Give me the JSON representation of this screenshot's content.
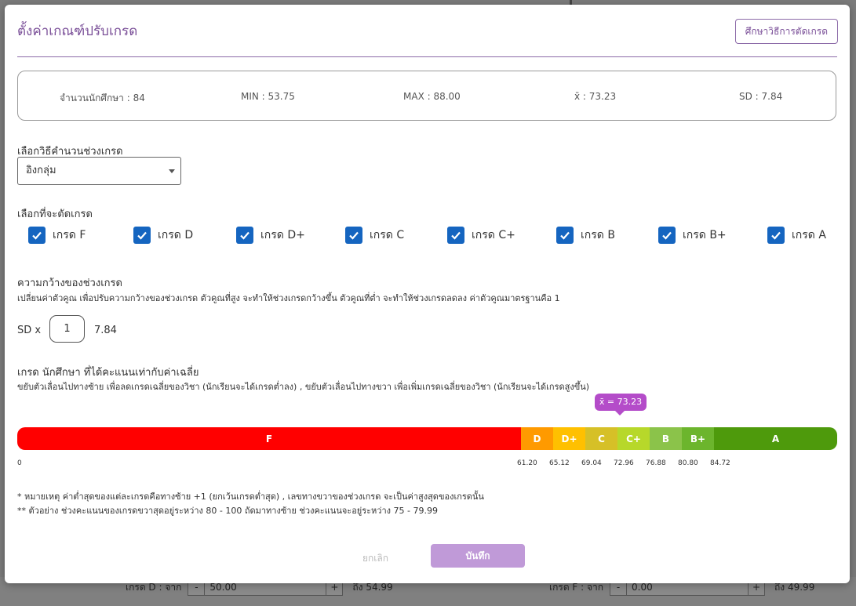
{
  "background": {
    "row_left": {
      "label": "เกรด D : จาก",
      "minus": "-",
      "value": "50.00",
      "plus": "+",
      "to": "ถึง 54.99"
    },
    "row_right": {
      "label": "เกรด F : จาก",
      "minus": "-",
      "value": "0.00",
      "plus": "+",
      "to": "ถึง 49.99"
    }
  },
  "modal": {
    "title": "ตั้งค่าเกณฑ์ปรับเกรด",
    "study_button": "ศึกษาวิธีการตัดเกรด"
  },
  "stats": {
    "count": "จำนวนนักศึกษา : 84",
    "min": "MIN : 53.75",
    "max": "MAX : 88.00",
    "mean": "x̄ : 73.23",
    "sd": "SD : 7.84"
  },
  "method": {
    "label": "เลือกวิธีคำนวนช่วงเกรด",
    "selected": "อิงกลุ่ม"
  },
  "cut_grades": {
    "label": "เลือกที่จะตัดเกรด",
    "items": [
      {
        "label": "เกรด F",
        "checked": true
      },
      {
        "label": "เกรด D",
        "checked": true
      },
      {
        "label": "เกรด D+",
        "checked": true
      },
      {
        "label": "เกรด C",
        "checked": true
      },
      {
        "label": "เกรด C+",
        "checked": true
      },
      {
        "label": "เกรด B",
        "checked": true
      },
      {
        "label": "เกรด B+",
        "checked": true
      },
      {
        "label": "เกรด A",
        "checked": true
      }
    ]
  },
  "width": {
    "label": "ความกว้างของช่วงเกรด",
    "description": "เปลี่ยนค่าตัวคูณ เพื่อปรับความกว้างของช่วงเกรด ตัวคูณที่สูง จะทำให้ช่วงเกรดกว้างขึ้น ตัวคูณที่ต่ำ จะทำให้ช่วงเกรดลดลง ค่าตัวคูณมาตรฐานคือ 1",
    "sd_label": "SD x",
    "multiplier": "1",
    "sd_value": "7.84"
  },
  "mean_grade": {
    "label": "เกรด นักศึกษา ที่ได้คะแนนเท่ากับค่าเฉลี่ย",
    "description": "ขยับตัวเลื่อนไปทางซ้าย เพื่อลดเกรดเฉลี่ยของวิชา (นักเรียนจะได้เกรดต่ำลง) , ขยับตัวเลื่อนไปทางขวา เพื่อเพิ่มเกรดเฉลี่ยของวิชา (นักเรียนจะได้เกรดสูงขึ้น)",
    "tooltip": "x̄ = 73.23"
  },
  "grade_bar": {
    "segments": [
      {
        "label": "F",
        "color": "#ff0000"
      },
      {
        "label": "D",
        "color": "#ff9a00"
      },
      {
        "label": "D+",
        "color": "#ffc000"
      },
      {
        "label": "C",
        "color": "#d6c027"
      },
      {
        "label": "C+",
        "color": "#b7d82a"
      },
      {
        "label": "B",
        "color": "#8bc34a"
      },
      {
        "label": "B+",
        "color": "#6cb52d"
      },
      {
        "label": "A",
        "color": "#4e9a0c"
      }
    ],
    "ticks": [
      "0",
      "61.20",
      "65.12",
      "69.04",
      "72.96",
      "76.88",
      "80.80",
      "84.72"
    ]
  },
  "notes": {
    "note1": "* หมายเหตุ ค่าต่ำสุดของแต่ละเกรดคือทางซ้าย +1 (ยกเว้นเกรดต่ำสุด) , เลขทางขวาของช่วงเกรด จะเป็นค่าสูงสุดของเกรดนั้น",
    "note2": "** ตัวอย่าง ช่วงคะแนนของเกรดขวาสุดอยู่ระหว่าง 80 - 100 ถัดมาทางซ้าย ช่วงคะแนนจะอยู่ระหว่าง 75 - 79.99"
  },
  "actions": {
    "cancel": "ยกเลิก",
    "save": "บันทึก"
  }
}
